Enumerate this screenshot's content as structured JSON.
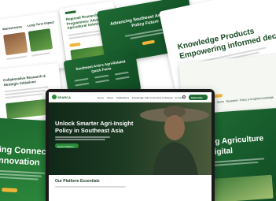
{
  "colors": {
    "dark_green": "#1f6a34",
    "accent_gold": "#f0b43a",
    "light_bg": "#ffffff"
  },
  "card_top_left_1": {
    "title": "Workstreams"
  },
  "card_top_left_2": {
    "title": "Long-Term Impact"
  },
  "card_top_center": {
    "title": "Regional Research Programmes: Advancing Agricultural Solutions"
  },
  "card_top_right": {
    "title": "Advancing Southeast Asia's Agri-Policy Future"
  },
  "card_mid_left": {
    "title": "Collaborative Research & Strategic Initiatives"
  },
  "card_mid_center": {
    "title": "Southeast Asia's Agri-Related Quick Facts"
  },
  "card_right_white": {
    "title_line1": "Knowledge Products",
    "title_line2": "Empowering informed decisions"
  },
  "card_bottom_left": {
    "title_line1": "ing Connections",
    "title_line2": "nnovation"
  },
  "card_bottom_right": {
    "title_line1": "ing Agriculture",
    "title_line2": "Digital"
  },
  "right_nav": {
    "items": [
      "Home",
      "Research",
      "Policy & Insights",
      "Knowledge"
    ]
  },
  "laptop_site": {
    "logo_text": "SEARCA",
    "nav_items": [
      "Home",
      "About",
      "Publications",
      "Knowledge Hub",
      "Community & Network",
      "Contact"
    ],
    "cta_label": "Subscribe",
    "hero_title_line1": "Unlock Smarter Agri-Insight",
    "hero_title_line2": "Policy in Southeast Asia",
    "hero_button": "Explore Platform",
    "section_title": "Our Platform Essentials"
  }
}
